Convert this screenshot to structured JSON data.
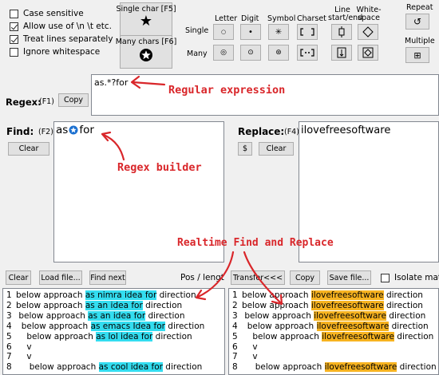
{
  "options": {
    "case_sensitive": {
      "label": "Case sensitive",
      "checked": false
    },
    "allow_escapes": {
      "label": "Allow use of \\n \\t etc.",
      "checked": true
    },
    "treat_lines": {
      "label": "Treat lines separately",
      "checked": true
    },
    "ignore_whitespace": {
      "label": "Ignore whitespace",
      "checked": false
    }
  },
  "builder": {
    "single_char": "Single char [F5]",
    "many_chars": "Many chars [F6]",
    "row_single": "Single",
    "row_many": "Many",
    "col_letter": "Letter",
    "col_digit": "Digit",
    "col_symbol": "Symbol",
    "col_charset": "Charset",
    "col_line": "Line\nstart/end",
    "col_white": "White-\nspace",
    "repeat": "Repeat",
    "multiple": "Multiple"
  },
  "regex": {
    "label": "Regex:",
    "hotkey": "(F1)",
    "copy": "Copy",
    "value": "as.*?for",
    "annotation": "Regular expression"
  },
  "find": {
    "label": "Find:",
    "hotkey": "(F2)",
    "clear": "Clear",
    "value_start": "as",
    "value_end": "for",
    "annotation": "Regex builder"
  },
  "replace": {
    "label": "Replace:",
    "hotkey": "(F4)",
    "dollar": "$",
    "clear": "Clear",
    "value": "ilovefreesoftware"
  },
  "center_annotation": "Realtime Find and Replace",
  "toolbar": {
    "clear": "Clear",
    "load": "Load file...",
    "find_next": "Find next",
    "pos": "Pos / lengtr",
    "transfer": "Transfer<<<",
    "copy": "Copy",
    "save": "Save file...",
    "isolate": "Isolate matc"
  },
  "left_lines": [
    {
      "n": "1",
      "indent": "",
      "pre": "below approach ",
      "match": "as nimra idea for",
      "post": " direction"
    },
    {
      "n": "2",
      "indent": "",
      "pre": "below approach ",
      "match": "as an idea for",
      "post": " direction"
    },
    {
      "n": "3",
      "indent": " ",
      "pre": "below approach ",
      "match": "as an idea for",
      "post": " direction"
    },
    {
      "n": "4",
      "indent": "  ",
      "pre": "below approach ",
      "match": "as emacs Idea for",
      "post": " direction"
    },
    {
      "n": "5",
      "indent": "    ",
      "pre": "below approach ",
      "match": "as lol idea for",
      "post": " direction"
    },
    {
      "n": "6",
      "indent": "    ",
      "pre": "v",
      "match": "",
      "post": ""
    },
    {
      "n": "7",
      "indent": "    ",
      "pre": "v",
      "match": "",
      "post": ""
    },
    {
      "n": "8",
      "indent": "     ",
      "pre": "below approach ",
      "match": "as cool idea for",
      "post": " direction"
    }
  ],
  "right_lines": [
    {
      "n": "1",
      "indent": "",
      "pre": "below approach ",
      "match": "ilovefreesoftware",
      "post": " direction"
    },
    {
      "n": "2",
      "indent": "",
      "pre": "below approach ",
      "match": "ilovefreesoftware",
      "post": " direction"
    },
    {
      "n": "3",
      "indent": " ",
      "pre": "below approach ",
      "match": "ilovefreesoftware",
      "post": " direction"
    },
    {
      "n": "4",
      "indent": "  ",
      "pre": "below approach ",
      "match": "ilovefreesoftware",
      "post": " direction"
    },
    {
      "n": "5",
      "indent": "    ",
      "pre": "below approach ",
      "match": "ilovefreesoftware",
      "post": " direction"
    },
    {
      "n": "6",
      "indent": "    ",
      "pre": "v",
      "match": "",
      "post": ""
    },
    {
      "n": "7",
      "indent": "    ",
      "pre": "v",
      "match": "",
      "post": ""
    },
    {
      "n": "8",
      "indent": "     ",
      "pre": "below approach ",
      "match": "ilovefreesoftware",
      "post": " direction"
    }
  ],
  "colors": {
    "annotation": "#d9262a",
    "find_highlight": "#33ddf0",
    "replace_highlight": "#f7b320"
  }
}
